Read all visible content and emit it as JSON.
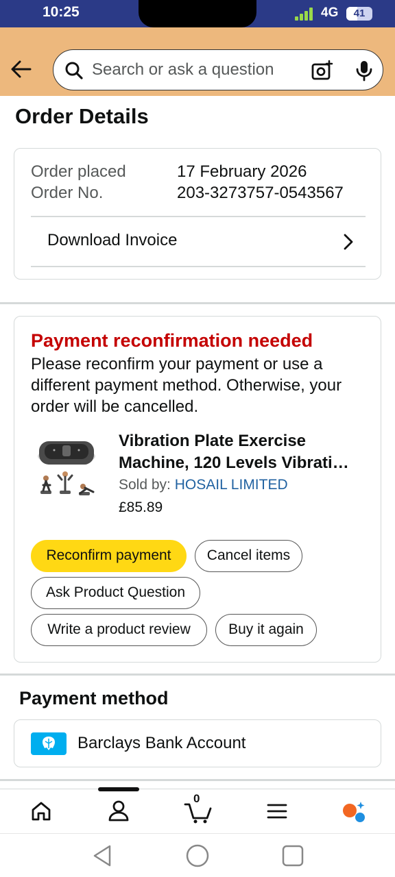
{
  "status_bar": {
    "time": "10:25",
    "network": "4G",
    "battery": "41",
    "battery_level_percent": 41
  },
  "header": {
    "search_placeholder": "Search or ask a question",
    "icons": [
      "back-arrow-icon",
      "search-icon",
      "camera-icon",
      "microphone-icon"
    ]
  },
  "page": {
    "title": "Order Details"
  },
  "order": {
    "placed_label": "Order placed",
    "placed_value": "17 February 2026",
    "number_label": "Order No.",
    "number_value": "203-3273757-0543567",
    "invoice_label": "Download Invoice"
  },
  "alert": {
    "title": "Payment reconfirmation needed",
    "message": "Please reconfirm your payment or use a different payment method. Otherwise, your order will be cancelled."
  },
  "product": {
    "title": "Vibration Plate Exercise Machine, 120 Levels Vibrati…",
    "sold_by_label": "Sold by: ",
    "seller": "HOSAIL LIMITED",
    "price": "£85.89"
  },
  "actions": {
    "reconfirm": "Reconfirm payment",
    "cancel": "Cancel items",
    "ask": "Ask Product Question",
    "review": "Write a product review",
    "buy_again": "Buy it again"
  },
  "payment_method": {
    "heading": "Payment method",
    "bank": "Barclays Bank Account"
  },
  "bottom_nav": {
    "cart_count": "0",
    "items": [
      "home-icon",
      "account-icon",
      "cart-icon",
      "menu-icon",
      "rufus-icon"
    ]
  },
  "colors": {
    "header_bg": "#edb87d",
    "status_bg": "#2b3a87",
    "alert_red": "#c40000",
    "primary_button": "#ffd814",
    "link_blue": "#2162a1",
    "bank_blue": "#00aeef"
  }
}
